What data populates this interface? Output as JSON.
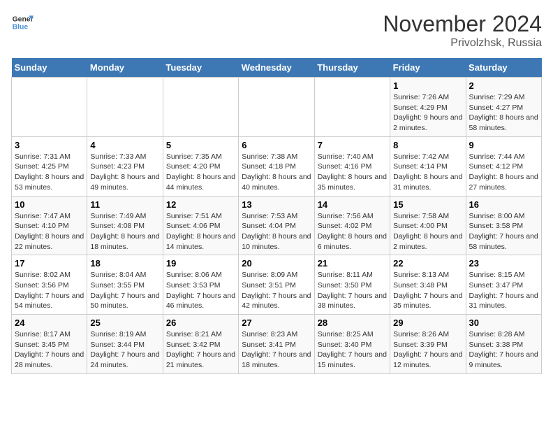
{
  "logo": {
    "line1": "General",
    "line2": "Blue"
  },
  "title": "November 2024",
  "location": "Privolzhsk, Russia",
  "days_of_week": [
    "Sunday",
    "Monday",
    "Tuesday",
    "Wednesday",
    "Thursday",
    "Friday",
    "Saturday"
  ],
  "weeks": [
    [
      {
        "day": "",
        "sunrise": "",
        "sunset": "",
        "daylight": ""
      },
      {
        "day": "",
        "sunrise": "",
        "sunset": "",
        "daylight": ""
      },
      {
        "day": "",
        "sunrise": "",
        "sunset": "",
        "daylight": ""
      },
      {
        "day": "",
        "sunrise": "",
        "sunset": "",
        "daylight": ""
      },
      {
        "day": "",
        "sunrise": "",
        "sunset": "",
        "daylight": ""
      },
      {
        "day": "1",
        "sunrise": "Sunrise: 7:26 AM",
        "sunset": "Sunset: 4:29 PM",
        "daylight": "Daylight: 9 hours and 2 minutes."
      },
      {
        "day": "2",
        "sunrise": "Sunrise: 7:29 AM",
        "sunset": "Sunset: 4:27 PM",
        "daylight": "Daylight: 8 hours and 58 minutes."
      }
    ],
    [
      {
        "day": "3",
        "sunrise": "Sunrise: 7:31 AM",
        "sunset": "Sunset: 4:25 PM",
        "daylight": "Daylight: 8 hours and 53 minutes."
      },
      {
        "day": "4",
        "sunrise": "Sunrise: 7:33 AM",
        "sunset": "Sunset: 4:23 PM",
        "daylight": "Daylight: 8 hours and 49 minutes."
      },
      {
        "day": "5",
        "sunrise": "Sunrise: 7:35 AM",
        "sunset": "Sunset: 4:20 PM",
        "daylight": "Daylight: 8 hours and 44 minutes."
      },
      {
        "day": "6",
        "sunrise": "Sunrise: 7:38 AM",
        "sunset": "Sunset: 4:18 PM",
        "daylight": "Daylight: 8 hours and 40 minutes."
      },
      {
        "day": "7",
        "sunrise": "Sunrise: 7:40 AM",
        "sunset": "Sunset: 4:16 PM",
        "daylight": "Daylight: 8 hours and 35 minutes."
      },
      {
        "day": "8",
        "sunrise": "Sunrise: 7:42 AM",
        "sunset": "Sunset: 4:14 PM",
        "daylight": "Daylight: 8 hours and 31 minutes."
      },
      {
        "day": "9",
        "sunrise": "Sunrise: 7:44 AM",
        "sunset": "Sunset: 4:12 PM",
        "daylight": "Daylight: 8 hours and 27 minutes."
      }
    ],
    [
      {
        "day": "10",
        "sunrise": "Sunrise: 7:47 AM",
        "sunset": "Sunset: 4:10 PM",
        "daylight": "Daylight: 8 hours and 22 minutes."
      },
      {
        "day": "11",
        "sunrise": "Sunrise: 7:49 AM",
        "sunset": "Sunset: 4:08 PM",
        "daylight": "Daylight: 8 hours and 18 minutes."
      },
      {
        "day": "12",
        "sunrise": "Sunrise: 7:51 AM",
        "sunset": "Sunset: 4:06 PM",
        "daylight": "Daylight: 8 hours and 14 minutes."
      },
      {
        "day": "13",
        "sunrise": "Sunrise: 7:53 AM",
        "sunset": "Sunset: 4:04 PM",
        "daylight": "Daylight: 8 hours and 10 minutes."
      },
      {
        "day": "14",
        "sunrise": "Sunrise: 7:56 AM",
        "sunset": "Sunset: 4:02 PM",
        "daylight": "Daylight: 8 hours and 6 minutes."
      },
      {
        "day": "15",
        "sunrise": "Sunrise: 7:58 AM",
        "sunset": "Sunset: 4:00 PM",
        "daylight": "Daylight: 8 hours and 2 minutes."
      },
      {
        "day": "16",
        "sunrise": "Sunrise: 8:00 AM",
        "sunset": "Sunset: 3:58 PM",
        "daylight": "Daylight: 7 hours and 58 minutes."
      }
    ],
    [
      {
        "day": "17",
        "sunrise": "Sunrise: 8:02 AM",
        "sunset": "Sunset: 3:56 PM",
        "daylight": "Daylight: 7 hours and 54 minutes."
      },
      {
        "day": "18",
        "sunrise": "Sunrise: 8:04 AM",
        "sunset": "Sunset: 3:55 PM",
        "daylight": "Daylight: 7 hours and 50 minutes."
      },
      {
        "day": "19",
        "sunrise": "Sunrise: 8:06 AM",
        "sunset": "Sunset: 3:53 PM",
        "daylight": "Daylight: 7 hours and 46 minutes."
      },
      {
        "day": "20",
        "sunrise": "Sunrise: 8:09 AM",
        "sunset": "Sunset: 3:51 PM",
        "daylight": "Daylight: 7 hours and 42 minutes."
      },
      {
        "day": "21",
        "sunrise": "Sunrise: 8:11 AM",
        "sunset": "Sunset: 3:50 PM",
        "daylight": "Daylight: 7 hours and 38 minutes."
      },
      {
        "day": "22",
        "sunrise": "Sunrise: 8:13 AM",
        "sunset": "Sunset: 3:48 PM",
        "daylight": "Daylight: 7 hours and 35 minutes."
      },
      {
        "day": "23",
        "sunrise": "Sunrise: 8:15 AM",
        "sunset": "Sunset: 3:47 PM",
        "daylight": "Daylight: 7 hours and 31 minutes."
      }
    ],
    [
      {
        "day": "24",
        "sunrise": "Sunrise: 8:17 AM",
        "sunset": "Sunset: 3:45 PM",
        "daylight": "Daylight: 7 hours and 28 minutes."
      },
      {
        "day": "25",
        "sunrise": "Sunrise: 8:19 AM",
        "sunset": "Sunset: 3:44 PM",
        "daylight": "Daylight: 7 hours and 24 minutes."
      },
      {
        "day": "26",
        "sunrise": "Sunrise: 8:21 AM",
        "sunset": "Sunset: 3:42 PM",
        "daylight": "Daylight: 7 hours and 21 minutes."
      },
      {
        "day": "27",
        "sunrise": "Sunrise: 8:23 AM",
        "sunset": "Sunset: 3:41 PM",
        "daylight": "Daylight: 7 hours and 18 minutes."
      },
      {
        "day": "28",
        "sunrise": "Sunrise: 8:25 AM",
        "sunset": "Sunset: 3:40 PM",
        "daylight": "Daylight: 7 hours and 15 minutes."
      },
      {
        "day": "29",
        "sunrise": "Sunrise: 8:26 AM",
        "sunset": "Sunset: 3:39 PM",
        "daylight": "Daylight: 7 hours and 12 minutes."
      },
      {
        "day": "30",
        "sunrise": "Sunrise: 8:28 AM",
        "sunset": "Sunset: 3:38 PM",
        "daylight": "Daylight: 7 hours and 9 minutes."
      }
    ]
  ]
}
